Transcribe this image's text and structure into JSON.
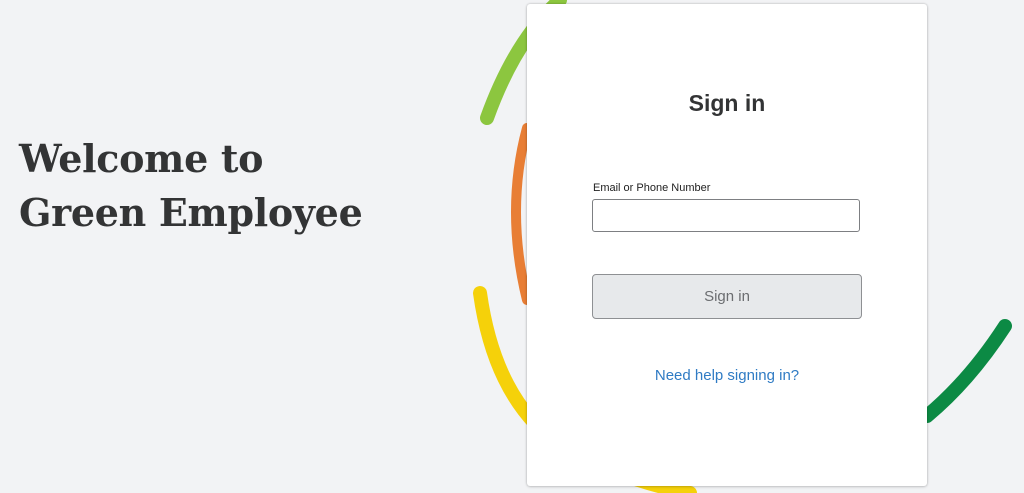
{
  "welcome": {
    "line1": "Welcome to",
    "line2": "Green Employee"
  },
  "signin_card": {
    "title": "Sign in",
    "email_label": "Email or Phone Number",
    "email_value": "",
    "email_placeholder": "",
    "submit_label": "Sign in",
    "help_link": "Need help signing in?"
  },
  "decoration": {
    "arc_colors": {
      "light_green": "#8cc63f",
      "orange": "#e87e35",
      "yellow": "#f5d10a",
      "dark_green": "#0c8a44"
    }
  },
  "colors": {
    "background": "#f2f3f5",
    "heading": "#333435",
    "link": "#2f7bc4",
    "button_bg": "#e7e9eb"
  }
}
